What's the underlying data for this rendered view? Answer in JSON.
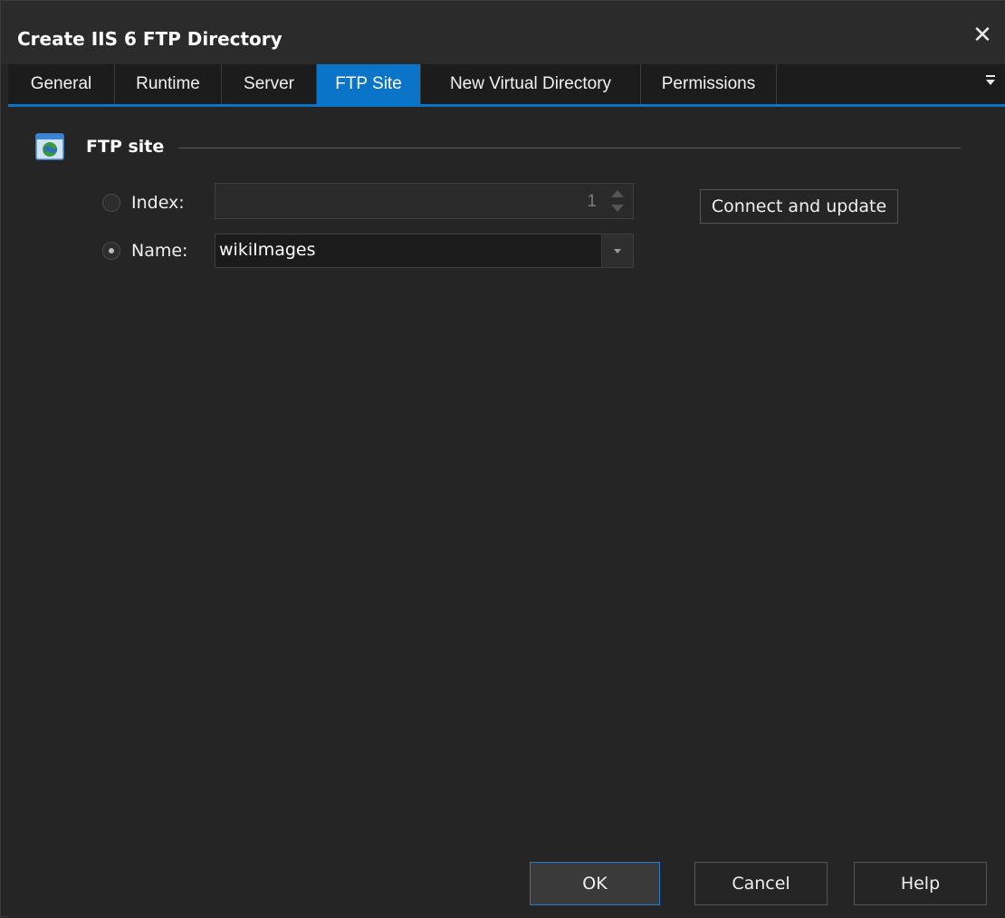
{
  "window": {
    "title": "Create IIS 6 FTP Directory"
  },
  "tabs": [
    {
      "label": "General"
    },
    {
      "label": "Runtime"
    },
    {
      "label": "Server"
    },
    {
      "label": "FTP Site",
      "active": true
    },
    {
      "label": "New Virtual Directory"
    },
    {
      "label": "Permissions"
    }
  ],
  "colors": {
    "accent": "#0a74c9",
    "background": "#252525",
    "tabbar": "#1c1c1c"
  },
  "ftp_site": {
    "group_label": "FTP site",
    "group_icon": "globe-window-icon",
    "index": {
      "label": "Index:",
      "value": "1",
      "selected": false
    },
    "name": {
      "label": "Name:",
      "value": "wikiImages",
      "selected": true
    },
    "connect_button": "Connect and update"
  },
  "footer": {
    "ok": "OK",
    "cancel": "Cancel",
    "help": "Help"
  }
}
